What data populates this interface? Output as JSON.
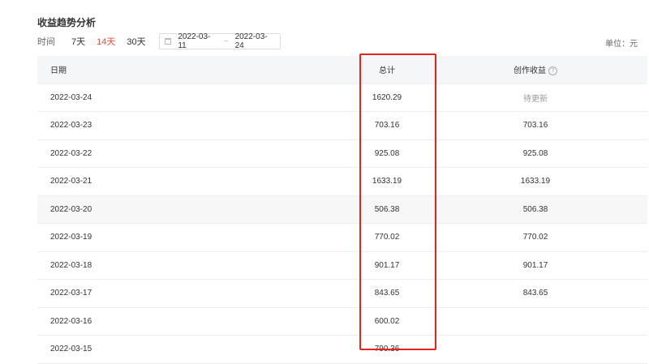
{
  "page": {
    "title": "收益趋势分析",
    "unit_label": "单位：元"
  },
  "filter": {
    "time_label": "时间",
    "ranges": [
      "7天",
      "14天",
      "30天"
    ],
    "selected": "14天",
    "start_date": "2022-03-11",
    "separator": "~",
    "end_date": "2022-03-24"
  },
  "table": {
    "headers": {
      "date": "日期",
      "total": "总计",
      "earnings": "创作收益",
      "help_icon": "?"
    },
    "rows": [
      {
        "date": "2022-03-24",
        "total": "1620.29",
        "earnings": "待更新"
      },
      {
        "date": "2022-03-23",
        "total": "703.16",
        "earnings": "703.16"
      },
      {
        "date": "2022-03-22",
        "total": "925.08",
        "earnings": "925.08"
      },
      {
        "date": "2022-03-21",
        "total": "1633.19",
        "earnings": "1633.19"
      },
      {
        "date": "2022-03-20",
        "total": "506.38",
        "earnings": "506.38"
      },
      {
        "date": "2022-03-19",
        "total": "770.02",
        "earnings": "770.02"
      },
      {
        "date": "2022-03-18",
        "total": "901.17",
        "earnings": "901.17"
      },
      {
        "date": "2022-03-17",
        "total": "843.65",
        "earnings": "843.65"
      },
      {
        "date": "2022-03-16",
        "total": "600.02",
        "earnings": ""
      },
      {
        "date": "2022-03-15",
        "total": "790.36",
        "earnings": ""
      }
    ]
  },
  "colors": {
    "accent": "#e8503a",
    "annotation": "#e8231d",
    "header_bg": "#f5f6f7"
  }
}
